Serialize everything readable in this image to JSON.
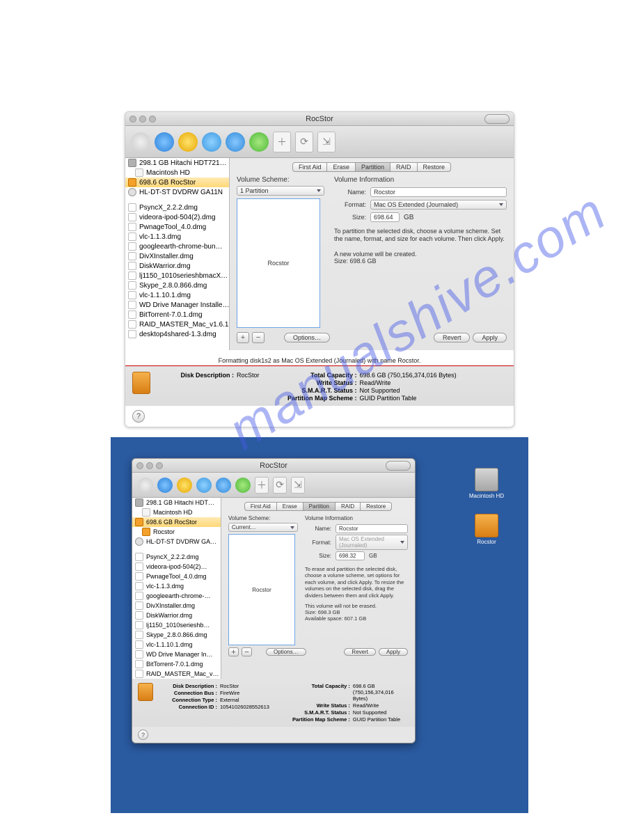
{
  "watermark": "manualshive.com",
  "s1": {
    "title": "RocStor",
    "sidebar": {
      "d0": "298.1 GB Hitachi HDT721…",
      "d0v": "Macintosh HD",
      "d1": "698.6 GB RocStor",
      "d2": "HL-DT-ST DVDRW GA11N",
      "dmg": [
        "PsyncX_2.2.2.dmg",
        "videora-ipod-504(2).dmg",
        "PwnageTool_4.0.dmg",
        "vlc-1.1.3.dmg",
        "googleearth-chrome-bun…",
        "DivXInstaller.dmg",
        "DiskWarrior.dmg",
        "lj1150_1010serieshbmacX…",
        "Skype_2.8.0.866.dmg",
        "vlc-1.1.10.1.dmg",
        "WD Drive Manager Installe…",
        "BitTorrent-7.0.1.dmg",
        "RAID_MASTER_Mac_v1.6.1…",
        "desktop4shared-1.3.dmg"
      ]
    },
    "tabs": [
      "First Aid",
      "Erase",
      "Partition",
      "RAID",
      "Restore"
    ],
    "activeTab": 2,
    "vs_label": "Volume Scheme:",
    "vs_value": "1 Partition",
    "vs_box": "Rocstor",
    "vi_label": "Volume Information",
    "name_l": "Name:",
    "name_v": "Rocstor",
    "format_l": "Format:",
    "format_v": "Mac OS Extended (Journaled)",
    "size_l": "Size:",
    "size_v": "698.64",
    "size_u": "GB",
    "para": "To partition the selected disk, choose a volume scheme. Set the name, format, and size for each volume. Then click Apply.",
    "note1": "A new volume will be created.",
    "note2": "Size: 698.6 GB",
    "options": "Options…",
    "revert": "Revert",
    "apply": "Apply",
    "status": "Formatting disk1s2 as Mac OS Extended (Journaled) with name Rocstor.",
    "desc_l": "Disk Description :",
    "desc_v": "RocStor",
    "cap_l": "Total Capacity :",
    "cap_v": "698.6 GB (750,156,374,016 Bytes)",
    "ws_l": "Write Status :",
    "ws_v": "Read/Write",
    "sm_l": "S.M.A.R.T. Status :",
    "sm_v": "Not Supported",
    "pm_l": "Partition Map Scheme :",
    "pm_v": "GUID Partition Table"
  },
  "s2": {
    "title": "RocStor",
    "desk_hd": "Macintosh HD",
    "desk_roc": "Rocstor",
    "sidebar": {
      "d0": "298.1 GB Hitachi HDT…",
      "d0v": "Macintosh HD",
      "d1": "698.6 GB RocStor",
      "d1v": "Rocstor",
      "d2": "HL-DT-ST DVDRW GA…",
      "dmg": [
        "PsyncX_2.2.2.dmg",
        "videora-ipod-504(2)…",
        "PwnageTool_4.0.dmg",
        "vlc-1.1.3.dmg",
        "googleearth-chrome-…",
        "DivXInstaller.dmg",
        "DiskWarrior.dmg",
        "lj1150_1010serieshb…",
        "Skype_2.8.0.866.dmg",
        "vlc-1.1.10.1.dmg",
        "WD Drive Manager In…",
        "BitTorrent-7.0.1.dmg",
        "RAID_MASTER_Mac_v…"
      ]
    },
    "tabs": [
      "First Aid",
      "Erase",
      "Partition",
      "RAID",
      "Restore"
    ],
    "activeTab": 2,
    "vs_label": "Volume Scheme:",
    "vs_value": "Current…",
    "vs_box": "Rocstor",
    "vi_label": "Volume Information",
    "name_l": "Name:",
    "name_v": "Rocstor",
    "format_l": "Format:",
    "format_v": "Mac OS Extended (Journaled)",
    "size_l": "Size:",
    "size_v": "698.32",
    "size_u": "GB",
    "para": "To erase and partition the selected disk, choose a volume scheme, set options for each volume, and click Apply. To resize the volumes on the selected disk, drag the dividers between them and click Apply.",
    "note1": "This volume will not be erased.",
    "note2": "Size: 698.3 GB",
    "note3": "Available space: 607.1 GB",
    "options": "Options…",
    "revert": "Revert",
    "apply": "Apply",
    "left": {
      "desc_l": "Disk Description :",
      "desc_v": "RocStor",
      "bus_l": "Connection Bus :",
      "bus_v": "FireWire",
      "type_l": "Connection Type :",
      "type_v": "External",
      "id_l": "Connection ID :",
      "id_v": "10541026028552613"
    },
    "right": {
      "cap_l": "Total Capacity :",
      "cap_v": "698.6 GB (750,156,374,016 Bytes)",
      "ws_l": "Write Status :",
      "ws_v": "Read/Write",
      "sm_l": "S.M.A.R.T. Status :",
      "sm_v": "Not Supported",
      "pm_l": "Partition Map Scheme :",
      "pm_v": "GUID Partition Table"
    }
  }
}
